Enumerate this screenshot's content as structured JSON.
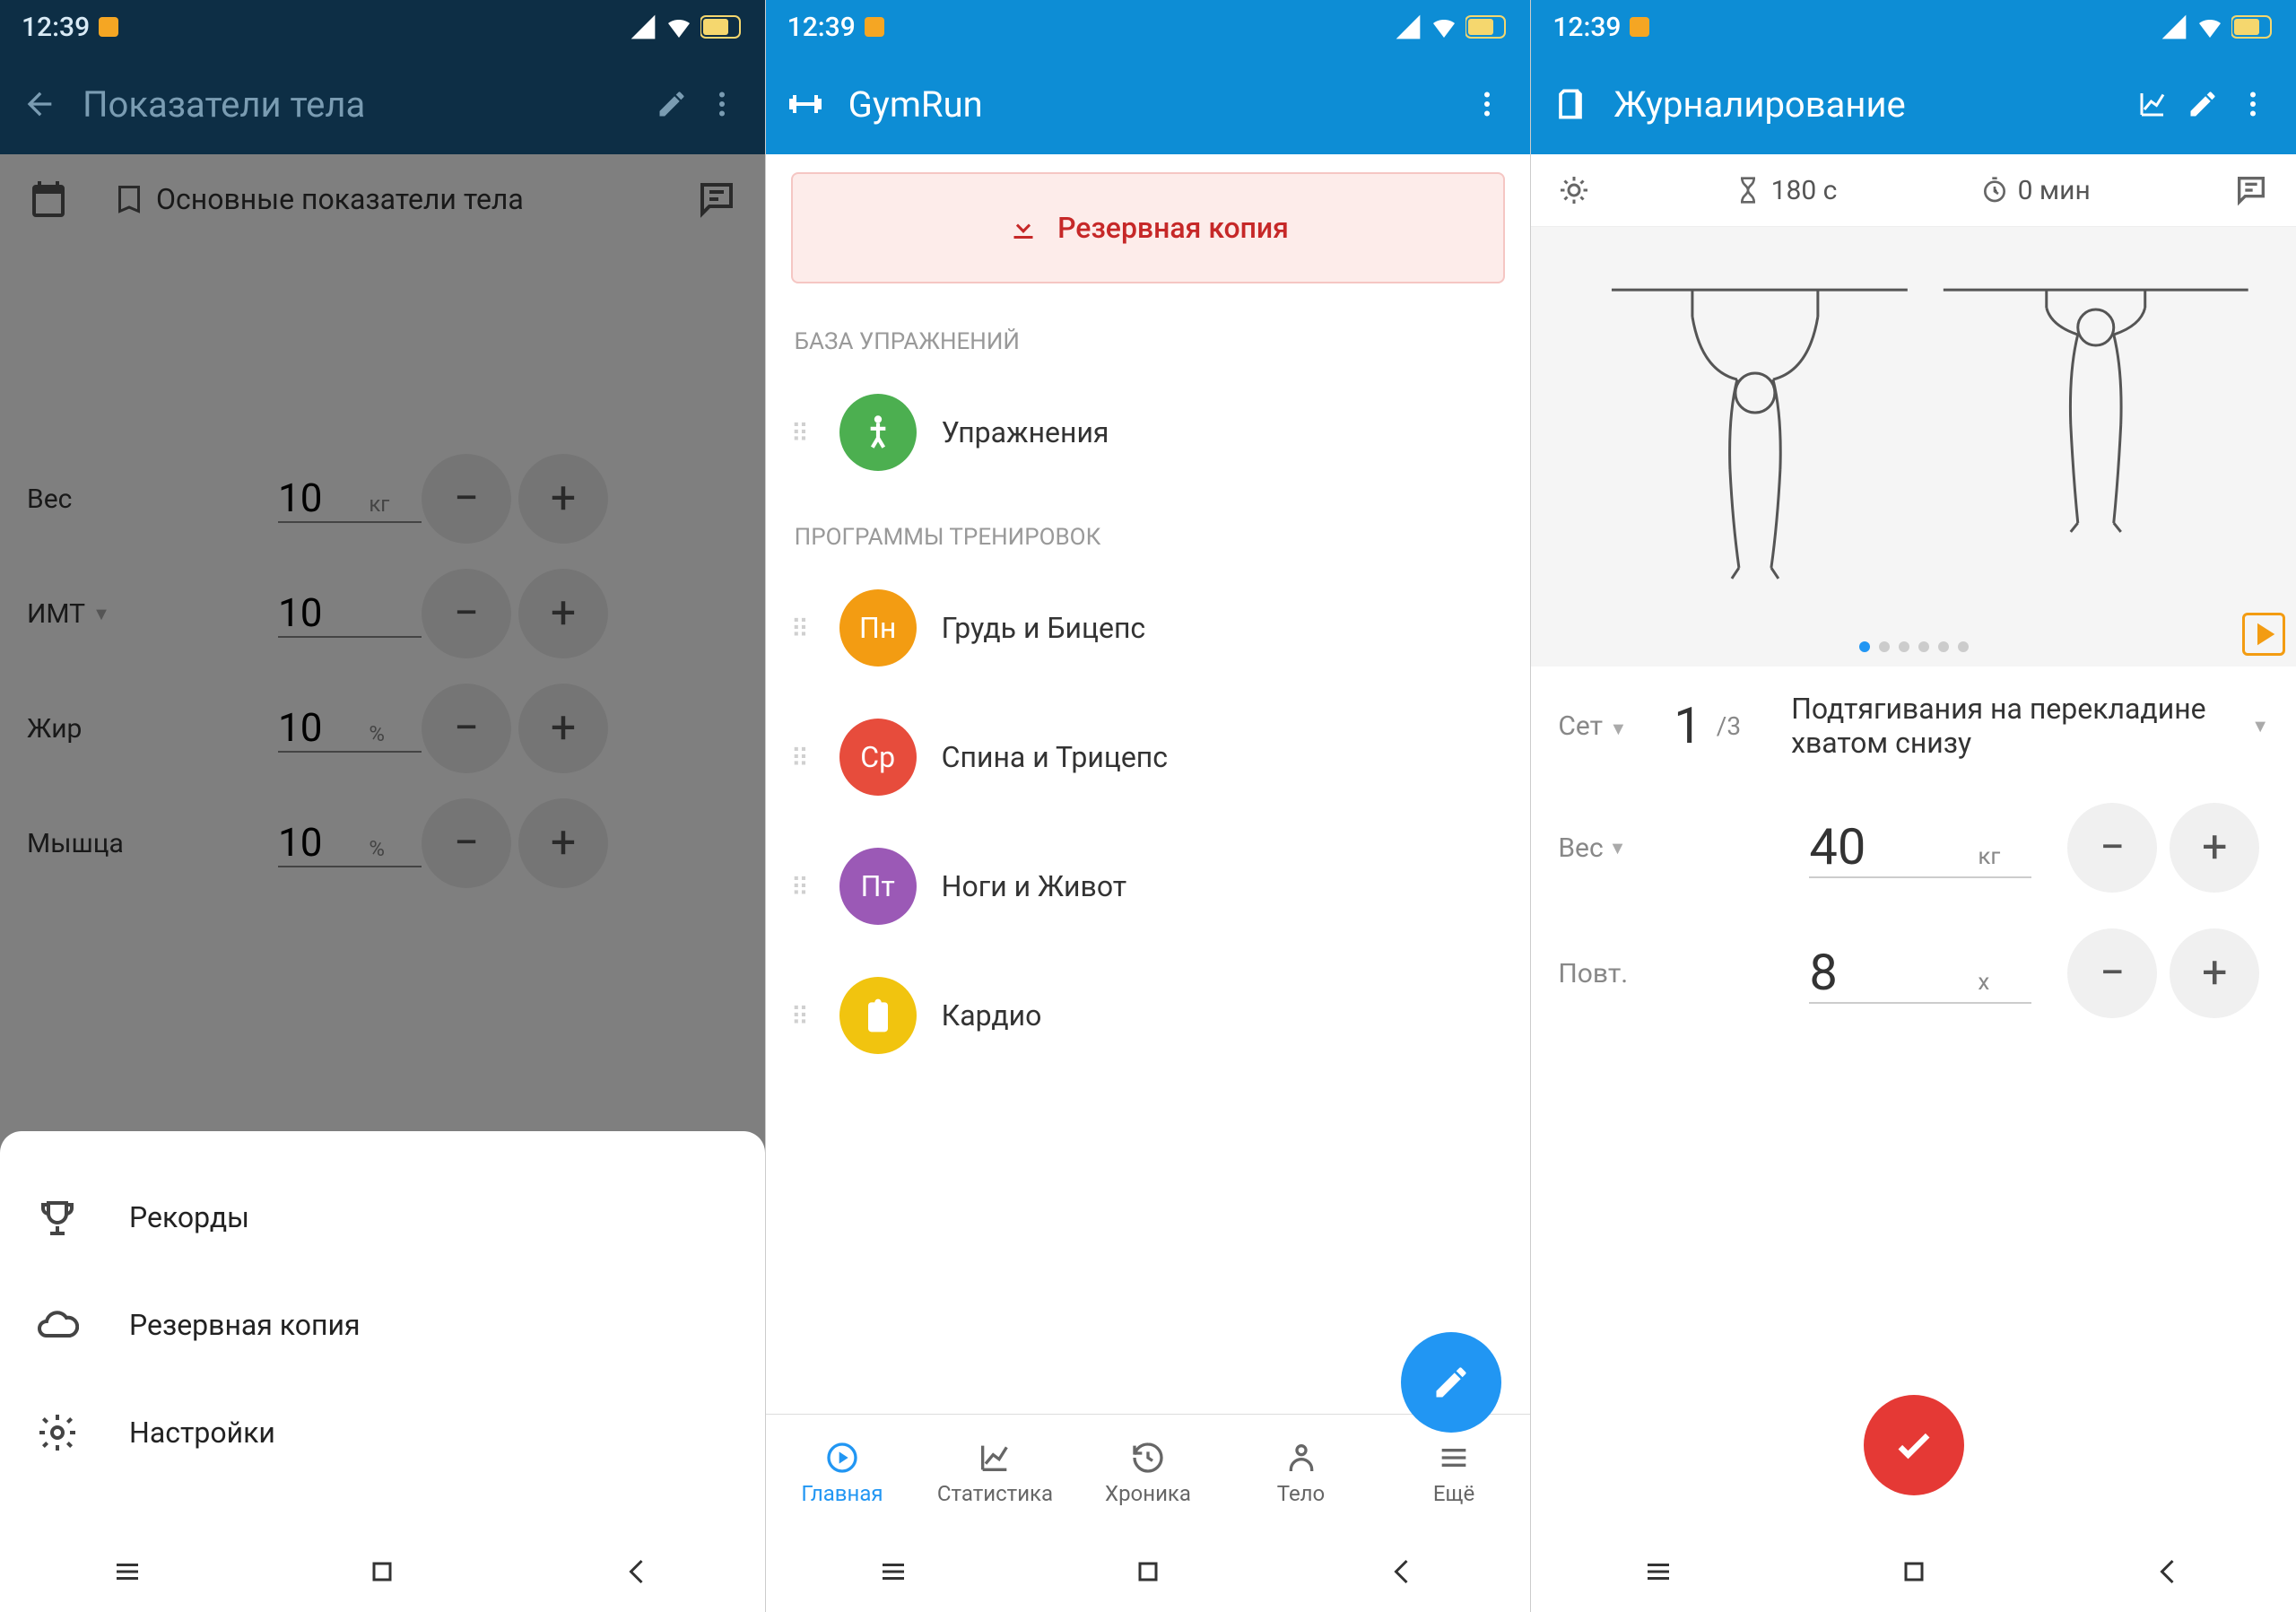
{
  "status": {
    "time": "12:39"
  },
  "s1": {
    "title": "Показатели тела",
    "header_label": "Основные показатели тела",
    "metrics": {
      "weight": {
        "label": "Вес",
        "value": "10",
        "unit": "кг"
      },
      "bmi": {
        "label": "ИМТ",
        "value": "10",
        "unit": ""
      },
      "fat": {
        "label": "Жир",
        "value": "10",
        "unit": "%"
      },
      "muscle": {
        "label": "Мышца",
        "value": "10",
        "unit": "%"
      }
    },
    "sheet": {
      "records": "Рекорды",
      "backup": "Резервная копия",
      "settings": "Настройки"
    }
  },
  "s2": {
    "app_title": "GymRun",
    "backup": "Резервная копия",
    "h_db": "БАЗА УПРАЖНЕНИЙ",
    "h_prog": "ПРОГРАММЫ ТРЕНИРОВОК",
    "exercises_label": "Упражнения",
    "prog1": {
      "badge": "Пн",
      "label": "Грудь и Бицепс"
    },
    "prog2": {
      "badge": "Ср",
      "label": "Спина и Трицепс"
    },
    "prog3": {
      "badge": "Пт",
      "label": "Ноги и Живот"
    },
    "prog4": {
      "label": "Кардио"
    },
    "nav": {
      "home": "Главная",
      "stats": "Статистика",
      "chron": "Хроника",
      "body": "Тело",
      "more": "Ещё"
    }
  },
  "s3": {
    "title": "Журналирование",
    "timer1": "180 с",
    "timer2": "0 мин",
    "set_label": "Сет",
    "set_cur": "1",
    "set_total": "/3",
    "ex_name": "Подтягивания на перекладине хватом снизу",
    "weight_label": "Вес",
    "weight_val": "40",
    "weight_unit": "кг",
    "reps_label": "Повт.",
    "reps_val": "8",
    "reps_unit": "x"
  }
}
